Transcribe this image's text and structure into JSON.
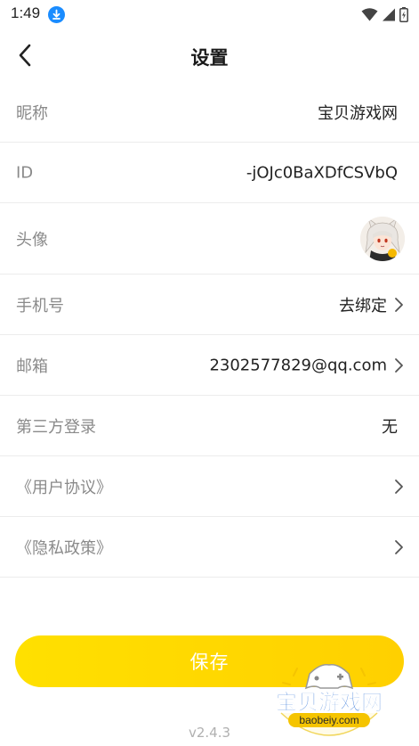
{
  "status_bar": {
    "time": "1:49",
    "icons": [
      "download-icon",
      "wifi-icon",
      "signal-icon",
      "battery-icon"
    ]
  },
  "nav": {
    "title": "设置",
    "back_icon": "chevron-left-icon"
  },
  "rows": [
    {
      "label": "昵称",
      "value": "宝贝游戏网"
    },
    {
      "label": "ID",
      "value": "-jOJc0BaXDfCSVbQ"
    },
    {
      "label": "头像",
      "avatar_icon": "anime-avatar"
    },
    {
      "label": "手机号",
      "value": "去绑定",
      "chevron": true
    },
    {
      "label": "邮箱",
      "value": "2302577829@qq.com",
      "chevron": true
    },
    {
      "label": "第三方登录",
      "value": "无"
    },
    {
      "label": "《用户协议》",
      "chevron": true
    },
    {
      "label": "《隐私政策》",
      "chevron": true
    }
  ],
  "save_button": {
    "label": "保存",
    "color": "#ffd900"
  },
  "version": "v2.4.3",
  "watermark": {
    "title": "宝贝游戏网",
    "url": "baobeiy.com"
  }
}
